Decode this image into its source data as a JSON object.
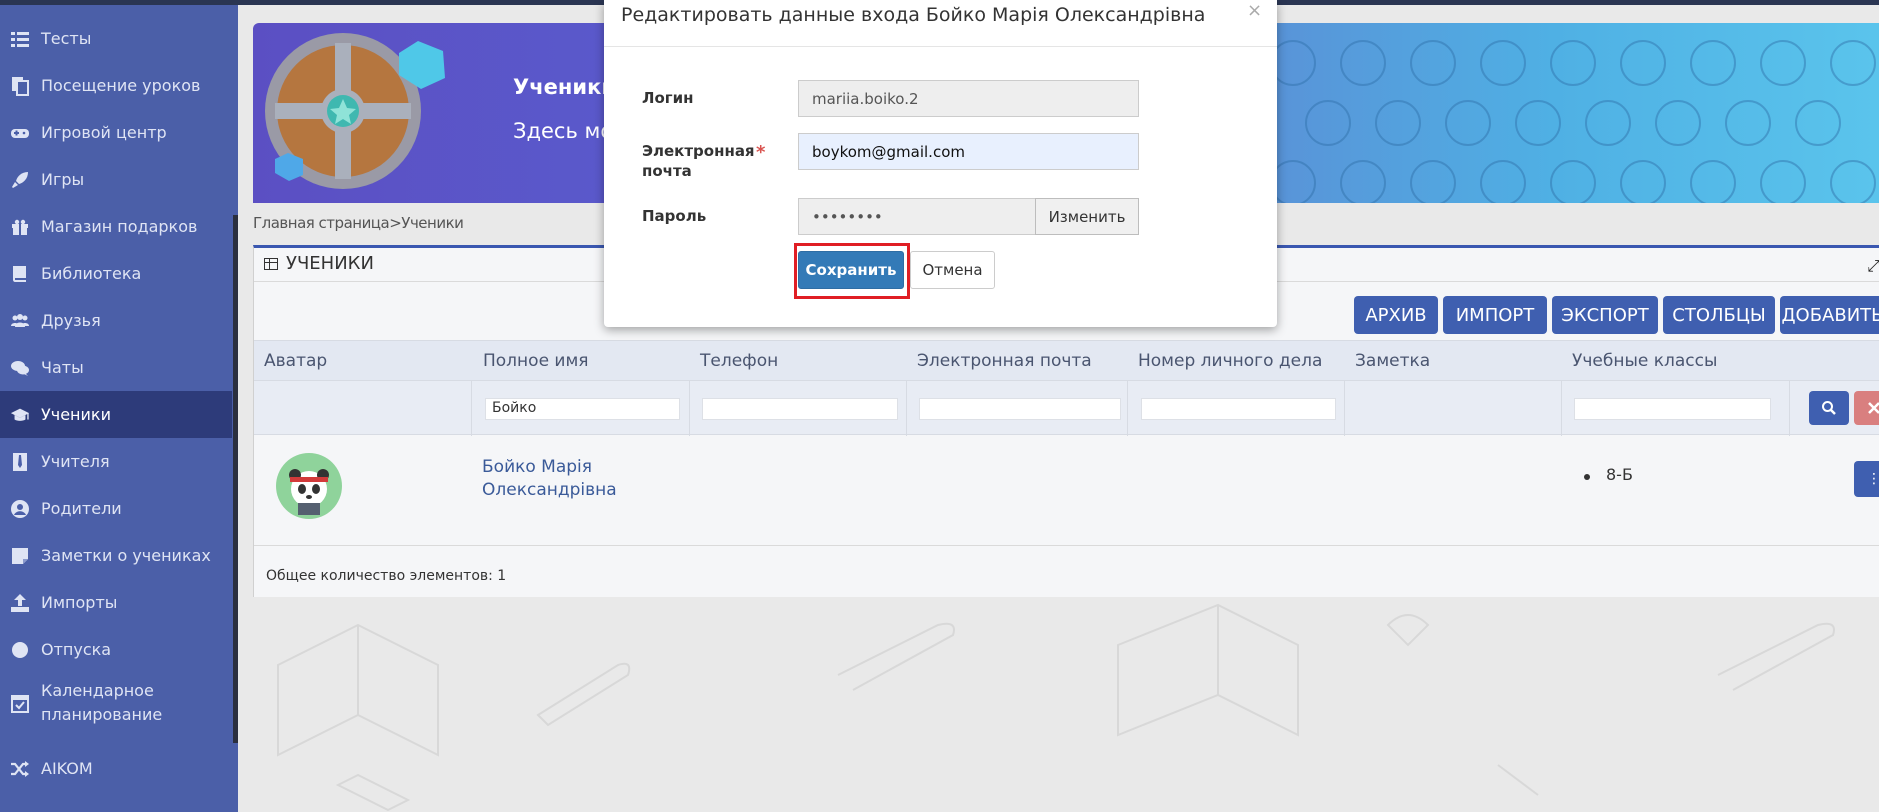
{
  "sidebar": {
    "items": [
      {
        "label": "Тесты",
        "icon": "list-icon"
      },
      {
        "label": "Посещение уроков",
        "icon": "document-copy-icon"
      },
      {
        "label": "Игровой центр",
        "icon": "gamepad-icon"
      },
      {
        "label": "Игры",
        "icon": "rocket-icon"
      },
      {
        "label": "Магазин подарков",
        "icon": "gift-icon"
      },
      {
        "label": "Библиотека",
        "icon": "book-icon"
      },
      {
        "label": "Друзья",
        "icon": "users-icon"
      },
      {
        "label": "Чаты",
        "icon": "chat-icon"
      },
      {
        "label": "Ученики",
        "icon": "graduation-cap-icon",
        "active": true
      },
      {
        "label": "Учителя",
        "icon": "tie-icon"
      },
      {
        "label": "Родители",
        "icon": "user-circle-icon"
      },
      {
        "label": "Заметки о учениках",
        "icon": "sticky-note-icon"
      },
      {
        "label": "Импорты",
        "icon": "upload-icon"
      },
      {
        "label": "Отпуска",
        "icon": "circle-icon"
      },
      {
        "label": "Календарное планирование",
        "icon": "calendar-check-icon"
      },
      {
        "label": "AIKOM",
        "icon": "shuffle-icon"
      }
    ]
  },
  "banner": {
    "title": "Ученики",
    "subtitle": "Здесь мож"
  },
  "breadcrumb": {
    "home": "Главная страница",
    "separator": ">",
    "current": "Ученики"
  },
  "panel": {
    "title": "УЧЕНИКИ",
    "buttons": {
      "archive": "АРХИВ",
      "import": "ИМПОРТ",
      "export": "ЭКСПОРТ",
      "columns": "СТОЛБЦЫ",
      "add": "ДОБАВИТЬ"
    },
    "columns": [
      "Аватар",
      "Полное имя",
      "Телефон",
      "Электронная почта",
      "Номер личного дела",
      "Заметка",
      "Учебные классы"
    ],
    "filters": {
      "name": "Бойко"
    },
    "rows": [
      {
        "name_line1": "Бойко Марія",
        "name_line2": "Олександрівна",
        "class": "8-Б"
      }
    ],
    "total_label": "Общее количество элементов: 1"
  },
  "modal": {
    "title": "Редактировать данные входа Бойко Марія Олександрівна",
    "close": "×",
    "login_label": "Логин",
    "login_value": "mariia.boiko.2",
    "email_label_1": "Электронная",
    "email_label_2": "почта",
    "required_mark": "*",
    "email_value": "boykom@gmail.com",
    "password_label": "Пароль",
    "password_value": "••••••••",
    "change_label": "Изменить",
    "save_label": "Сохранить",
    "cancel_label": "Отмена"
  },
  "colors": {
    "sidebar_bg": "#4b5fa8",
    "sidebar_active": "#2d3b7a",
    "primary": "#337ab7",
    "toolbar_button": "#3f5fb0",
    "highlight": "#e01e24",
    "danger": "#d9534f"
  }
}
